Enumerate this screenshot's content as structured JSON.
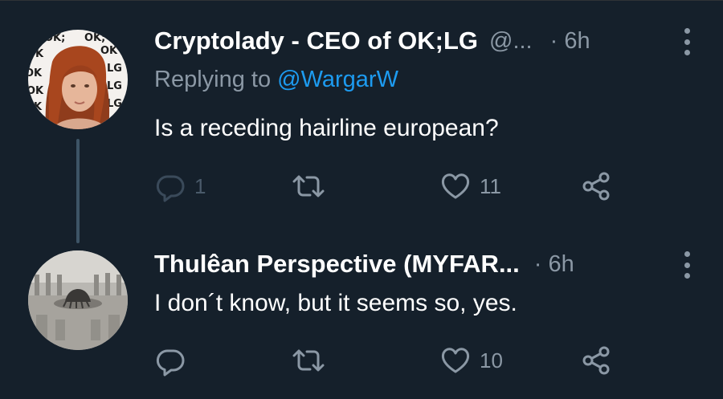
{
  "tweets": [
    {
      "display_name": "Cryptolady - CEO of OK;LG",
      "handle": "@...",
      "time": "· 6h",
      "replying_prefix": "Replying to",
      "replying_to": "@WargarW",
      "text": "Is a receding hairline european?",
      "reply_count": "1",
      "retweet_count": "",
      "like_count": "11",
      "avatar_icon": "profile-photo-red-haired-woman"
    },
    {
      "display_name": "Thulêan Perspective (MYFAR...",
      "handle": "",
      "time": "· 6h",
      "text": "I don´t know, but it seems so, yes.",
      "reply_count": "",
      "retweet_count": "",
      "like_count": "10",
      "avatar_icon": "profile-photo-grayscale-monument"
    }
  ],
  "icons": {
    "reply": "reply-icon",
    "retweet": "retweet-icon",
    "like": "heart-icon",
    "share": "share-icon",
    "more": "more-options-icon"
  },
  "colors": {
    "background": "#15202b",
    "text": "#ffffff",
    "muted": "#8b98a5",
    "link": "#1d9bf0"
  }
}
